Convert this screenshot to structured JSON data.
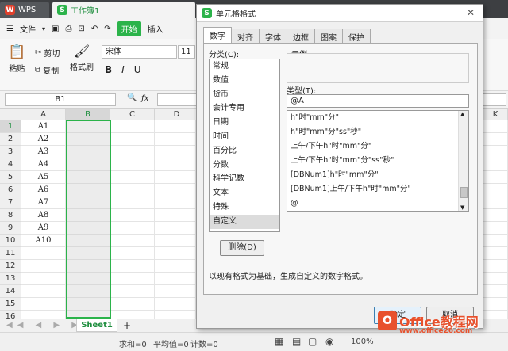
{
  "tabs": {
    "wps": "WPS",
    "workbook": "工作簿1"
  },
  "menu": {
    "file": "文件",
    "start": "开始",
    "insert": "插入"
  },
  "ribbon": {
    "paste": "粘贴",
    "cut": "剪切",
    "copy": "复制",
    "format_painter": "格式刷",
    "font": "宋体",
    "size": "11",
    "bold": "B",
    "italic": "I",
    "underline": "U"
  },
  "formula": {
    "namebox": "B1",
    "fx": "fx"
  },
  "columns": [
    "A",
    "B",
    "C",
    "D",
    "K"
  ],
  "rows": [
    "1",
    "2",
    "3",
    "4",
    "5",
    "6",
    "7",
    "8",
    "9",
    "10",
    "11",
    "12",
    "13",
    "14",
    "15",
    "16",
    "17"
  ],
  "cells_a": [
    "A1",
    "A2",
    "A3",
    "A4",
    "A5",
    "A6",
    "A7",
    "A8",
    "A9",
    "A10"
  ],
  "sheet": {
    "tab": "Sheet1",
    "add": "+"
  },
  "status": {
    "sum": "求和=0",
    "avg": "平均值=0",
    "count": "计数=0",
    "zoom": "100%"
  },
  "dialog": {
    "title": "单元格格式",
    "tabs": [
      "数字",
      "对齐",
      "字体",
      "边框",
      "图案",
      "保护"
    ],
    "category_label": "分类(C):",
    "categories": [
      "常规",
      "数值",
      "货币",
      "会计专用",
      "日期",
      "时间",
      "百分比",
      "分数",
      "科学记数",
      "文本",
      "特殊",
      "自定义"
    ],
    "sample_label": "示例",
    "type_label": "类型(T):",
    "type_value": "@A",
    "type_items": [
      "h\"时\"mm\"分\"",
      "h\"时\"mm\"分\"ss\"秒\"",
      "上午/下午h\"时\"mm\"分\"",
      "上午/下午h\"时\"mm\"分\"ss\"秒\"",
      "[DBNum1]h\"时\"mm\"分\"",
      "[DBNum1]上午/下午h\"时\"mm\"分\"",
      "@"
    ],
    "delete": "删除(D)",
    "note": "以现有格式为基础，生成自定义的数字格式。",
    "ok": "确定",
    "cancel": "取消"
  },
  "watermark": {
    "logo": "O",
    "text": "Office教程网",
    "sub": "www.office26.com"
  },
  "colors": {
    "green": "#1e8e3e",
    "accent": "#2bb34a",
    "brand_orange": "#e8512d"
  }
}
